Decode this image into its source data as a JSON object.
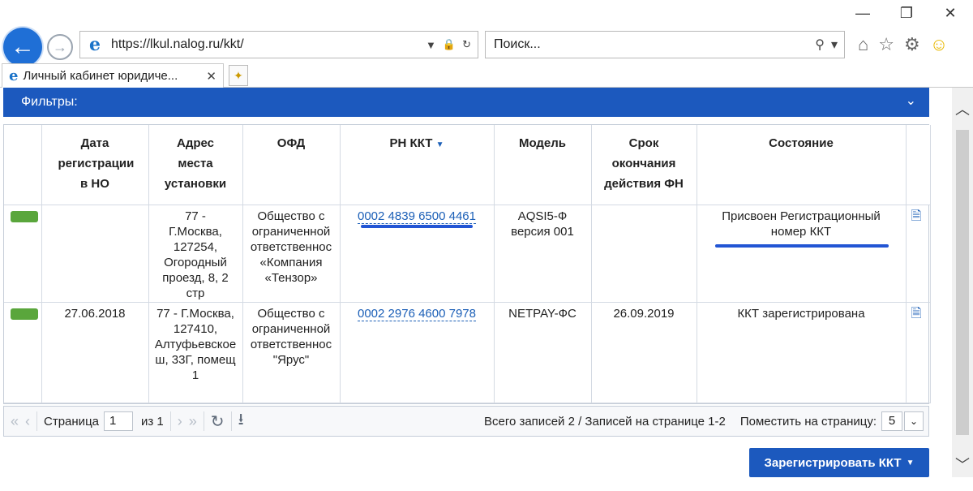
{
  "browser": {
    "url": "https://lkul.nalog.ru/kkt/",
    "search_placeholder": "Поиск...",
    "tab_title": "Личный кабинет юридиче...",
    "tab_close": "✕"
  },
  "filters": {
    "label": "Фильтры:"
  },
  "table": {
    "headers": {
      "reg_date": "Дата регистрации в НО",
      "address": "Адрес места установки",
      "ofd": "ОФД",
      "rn": "РН ККТ",
      "model": "Модель",
      "fn_term": "Срок окончания действия ФН",
      "state": "Состояние"
    },
    "rows": [
      {
        "reg_date": "",
        "address": "77 - Г.Москва, 127254, Огородный проезд, 8, 2 стр",
        "ofd": "Общество с ограниченной ответственнос «Компания «Тензор»",
        "rn": "0002 4839 6500 4461",
        "model": "AQSI5-Ф версия 001",
        "fn_term": "",
        "state": "Присвоен Регистрационный номер ККТ"
      },
      {
        "reg_date": "27.06.2018",
        "address": "77 - Г.Москва, 127410, Алтуфьевское ш, 33Г, помещ 1",
        "ofd": "Общество с ограниченной ответственнос \"Ярус\"",
        "rn": "0002 2976 4600 7978",
        "model": "NETPAY-ФС",
        "fn_term": "26.09.2019",
        "state": "ККТ зарегистрирована"
      }
    ],
    "status_color": "#5aa63c"
  },
  "pager": {
    "page_label": "Страница",
    "page_value": "1",
    "of_label": "из 1",
    "total_text": "Всего записей 2 / Записей на странице 1-2",
    "per_page_label": "Поместить на страницу:",
    "per_page_value": "5"
  },
  "actions": {
    "register_label": "Зарегистрировать ККТ"
  },
  "colors": {
    "accent": "#1c59be",
    "link": "#1b5fb7",
    "highlight": "#2255d4"
  }
}
